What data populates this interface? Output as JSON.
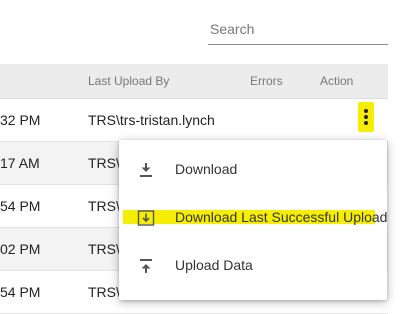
{
  "search": {
    "placeholder": "Search"
  },
  "table": {
    "columns": {
      "last_upload_by": "Last Upload By",
      "errors": "Errors",
      "action": "Action"
    },
    "rows": [
      {
        "time": "32 PM",
        "user": "TRS\\trs-tristan.lynch"
      },
      {
        "time": "17 AM",
        "user": "TRS\\"
      },
      {
        "time": "54 PM",
        "user": "TRS\\"
      },
      {
        "time": "02 PM",
        "user": "TRS\\"
      },
      {
        "time": "54 PM",
        "user": "TRS\\"
      }
    ]
  },
  "menu": {
    "items": [
      {
        "label": "Download",
        "icon": "download-icon"
      },
      {
        "label": "Download Last Successful Upload",
        "icon": "download-last-icon",
        "highlighted": true
      },
      {
        "label": "Upload Data",
        "icon": "upload-icon"
      }
    ]
  },
  "colors": {
    "highlight": "#f6ee00",
    "header_bg": "#ececec",
    "alt_row": "#f3f3f3"
  }
}
